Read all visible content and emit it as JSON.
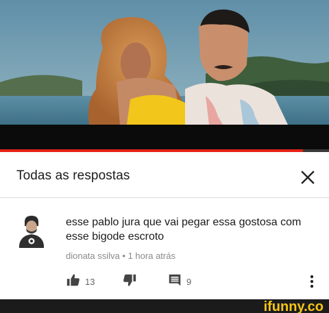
{
  "video": {
    "progress_fraction": 0.92,
    "accent_color": "#e62117"
  },
  "panel": {
    "title": "Todas as respostas",
    "close_icon": "close-icon"
  },
  "comment": {
    "avatar_icon": "avatar",
    "text": "esse pablo jura que vai pegar essa gostosa com esse bigode escroto",
    "author": "dionata ssilva",
    "separator": "•",
    "time": "1 hora atrás",
    "likes": "13",
    "replies": "9",
    "like_icon": "thumbs-up-icon",
    "dislike_icon": "thumbs-down-icon",
    "reply_icon": "reply-icon",
    "more_icon": "more-vert-icon"
  },
  "watermark": {
    "text": "ifunny.co",
    "color": "#f5c518"
  }
}
